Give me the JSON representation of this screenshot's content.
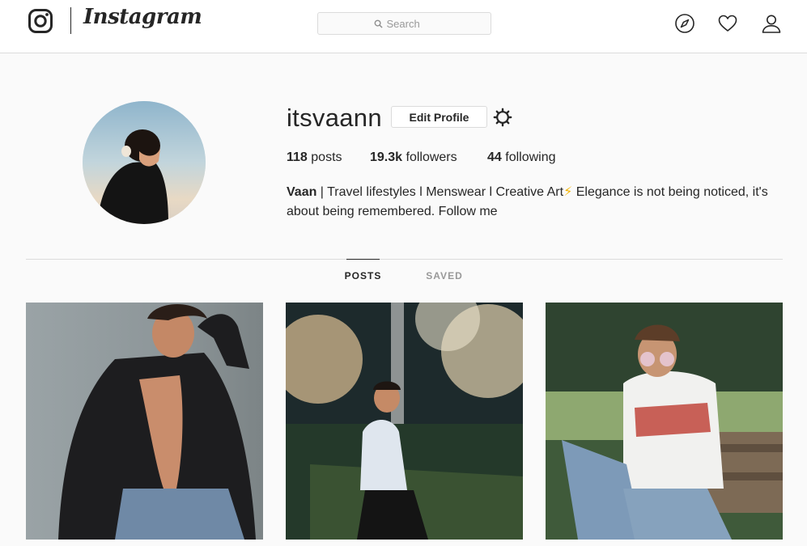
{
  "header": {
    "wordmark": "Instagram",
    "search_placeholder": "Search",
    "icons": [
      "instagram-logo-icon",
      "search-icon",
      "compass-icon",
      "heart-icon",
      "person-icon"
    ]
  },
  "profile": {
    "username": "itsvaann",
    "edit_button": "Edit Profile",
    "stats": {
      "posts_count": "118",
      "posts_label": "posts",
      "followers_count": "19.3k",
      "followers_label": "followers",
      "following_count": "44",
      "following_label": "following"
    },
    "bio": {
      "name": "Vaan",
      "line1": " | Travel lifestyles l Menswear l Creative Art",
      "emoji": "⚡",
      "line1_end": " Elegance is not being noticed, it's",
      "line2": "about being remembered. Follow me"
    }
  },
  "tabs": [
    {
      "label": "POSTS",
      "active": true
    },
    {
      "label": "SAVED",
      "active": false
    }
  ],
  "colors": {
    "background": "#fafafa",
    "text": "#262626",
    "border": "#dbdbdb",
    "muted": "#999999",
    "lightning": "#f5b400"
  }
}
